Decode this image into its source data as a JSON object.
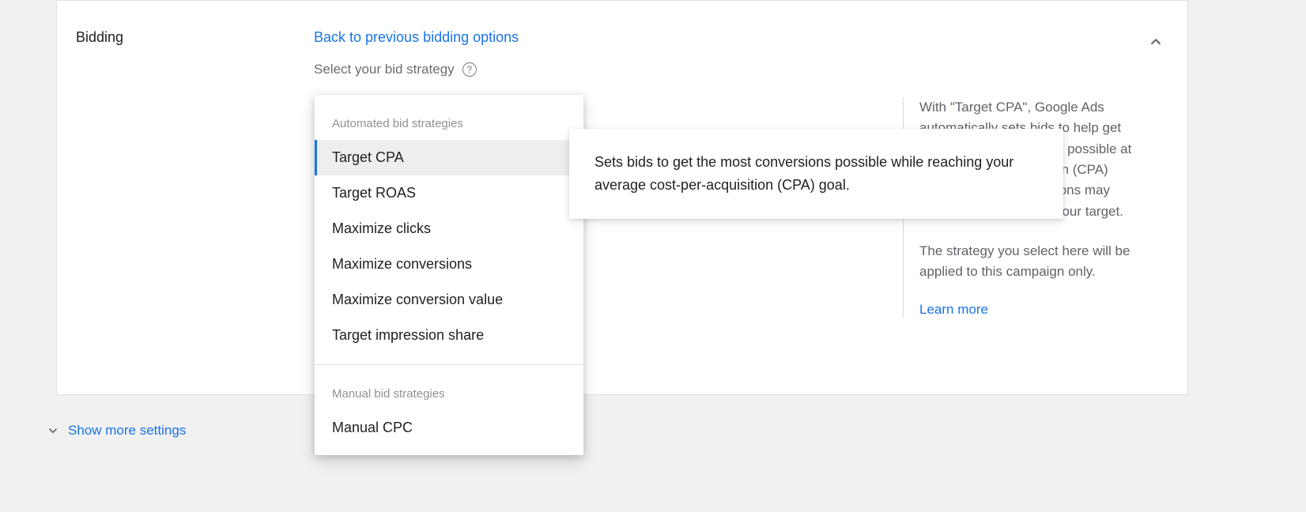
{
  "section": {
    "title": "Bidding",
    "back_link": "Back to previous bidding options",
    "select_label": "Select your bid strategy"
  },
  "dropdown": {
    "group1_label": "Automated bid strategies",
    "items1": {
      "target_cpa": "Target CPA",
      "target_roas": "Target ROAS",
      "maximize_clicks": "Maximize clicks",
      "maximize_conversions": "Maximize conversions",
      "maximize_conversion_value": "Maximize conversion value",
      "target_impression_share": "Target impression share"
    },
    "group2_label": "Manual bid strategies",
    "items2": {
      "manual_cpc": "Manual CPC"
    }
  },
  "tooltip": {
    "text": "Sets bids to get the most conversions possible while reaching your average cost-per-acquisition (CPA) goal."
  },
  "side_panel": {
    "para1": "With \"Target CPA\", Google Ads automatically sets bids to help get as many conversions as possible at the target cost-per-action (CPA) you set. Some conversions may cost more or less than your target.",
    "para2": "The strategy you select here will be applied to this campaign only.",
    "learn_more": "Learn more"
  },
  "show_more": "Show more settings"
}
